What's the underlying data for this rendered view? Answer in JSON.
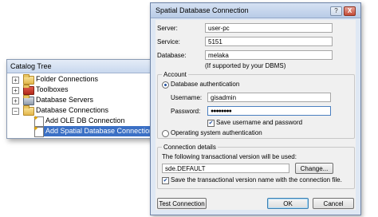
{
  "catalog": {
    "title": "Catalog Tree",
    "items": [
      {
        "label": "Folder Connections",
        "expander": "+"
      },
      {
        "label": "Toolboxes",
        "expander": "+"
      },
      {
        "label": "Database Servers",
        "expander": "+"
      },
      {
        "label": "Database Connections",
        "expander": "−"
      },
      {
        "label": "Add OLE DB Connection"
      },
      {
        "label": "Add Spatial Database Connection"
      }
    ]
  },
  "dialog": {
    "title": "Spatial Database Connection",
    "buttons": {
      "help": "?",
      "close": "X"
    },
    "server": {
      "label": "Server:",
      "value": "user-pc"
    },
    "service": {
      "label": "Service:",
      "value": "5151"
    },
    "database": {
      "label": "Database:",
      "value": "melaka",
      "note": "(If supported by your DBMS)"
    },
    "account": {
      "group_title": "Account",
      "db_auth": "Database authentication",
      "username": {
        "label": "Username:",
        "value": "gisadmin"
      },
      "password": {
        "label": "Password:",
        "value": "●●●●●●●●"
      },
      "save_credentials": "Save username and password",
      "os_auth": "Operating system authentication"
    },
    "connection_details": {
      "group_title": "Connection details",
      "version_label": "The following transactional version will be used:",
      "version_value": "sde.DEFAULT",
      "change_button": "Change...",
      "save_version": "Save the transactional version name with the connection file."
    },
    "footer": {
      "test_button": "Test Connection",
      "ok_button": "OK",
      "cancel_button": "Cancel"
    }
  }
}
